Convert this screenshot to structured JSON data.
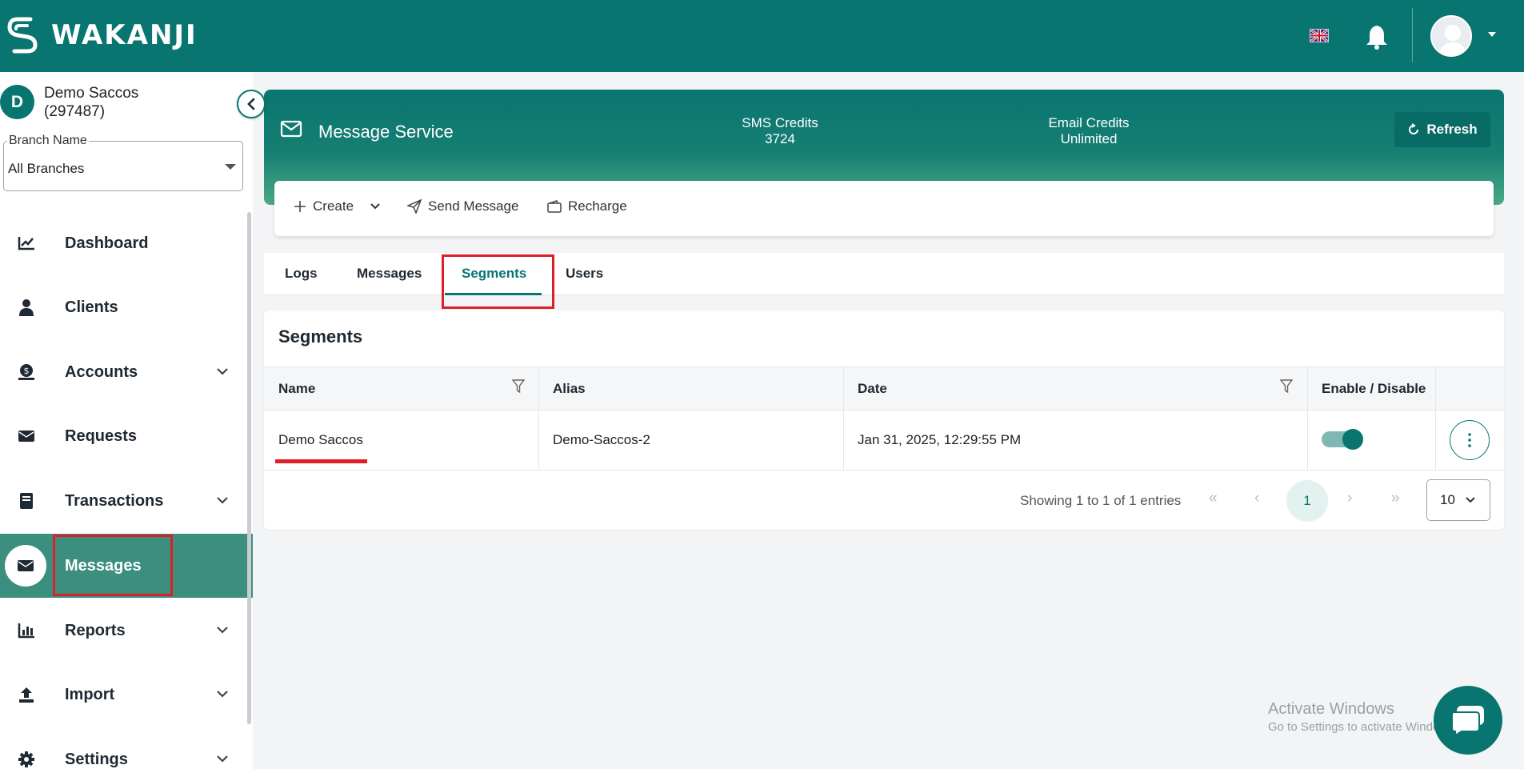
{
  "brand": {
    "name": "WAKANJI",
    "accent": "#087570"
  },
  "topbar": {
    "language_icon": "uk-flag-icon",
    "notifications_icon": "bell-icon",
    "avatar_icon": "user-avatar-icon"
  },
  "org": {
    "initial": "D",
    "name": "Demo Saccos",
    "code": "(297487)"
  },
  "branch": {
    "label": "Branch Name",
    "value": "All Branches"
  },
  "nav": [
    {
      "label": "Dashboard",
      "icon": "chart-icon",
      "expandable": false
    },
    {
      "label": "Clients",
      "icon": "person-icon",
      "expandable": false
    },
    {
      "label": "Accounts",
      "icon": "money-icon",
      "expandable": true
    },
    {
      "label": "Requests",
      "icon": "envelope-icon",
      "expandable": false
    },
    {
      "label": "Transactions",
      "icon": "book-icon",
      "expandable": true
    },
    {
      "label": "Messages",
      "icon": "envelope-icon",
      "expandable": false,
      "active": true
    },
    {
      "label": "Reports",
      "icon": "bar-chart-icon",
      "expandable": true
    },
    {
      "label": "Import",
      "icon": "upload-icon",
      "expandable": true
    },
    {
      "label": "Settings",
      "icon": "gear-icon",
      "expandable": true
    }
  ],
  "hero": {
    "title": "Message Service",
    "sms_label": "SMS Credits",
    "sms_value": "3724",
    "email_label": "Email Credits",
    "email_value": "Unlimited",
    "refresh_label": "Refresh"
  },
  "actions": {
    "create": "Create",
    "send": "Send Message",
    "recharge": "Recharge"
  },
  "tabs": [
    "Logs",
    "Messages",
    "Segments",
    "Users"
  ],
  "active_tab": "Segments",
  "segments": {
    "title": "Segments",
    "columns": {
      "name": "Name",
      "alias": "Alias",
      "date": "Date",
      "enable": "Enable / Disable"
    },
    "rows": [
      {
        "name": "Demo Saccos",
        "alias": "Demo-Saccos-2",
        "date": "Jan 31, 2025, 12:29:55 PM",
        "enabled": true
      }
    ],
    "pagination": {
      "info": "Showing 1 to 1 of 1 entries",
      "page": "1",
      "page_size": "10",
      "first": "«",
      "prev": "‹",
      "next": "›",
      "last": "»"
    }
  },
  "watermark": {
    "line1": "Activate Windows",
    "line2": "Go to Settings to activate Windows."
  }
}
